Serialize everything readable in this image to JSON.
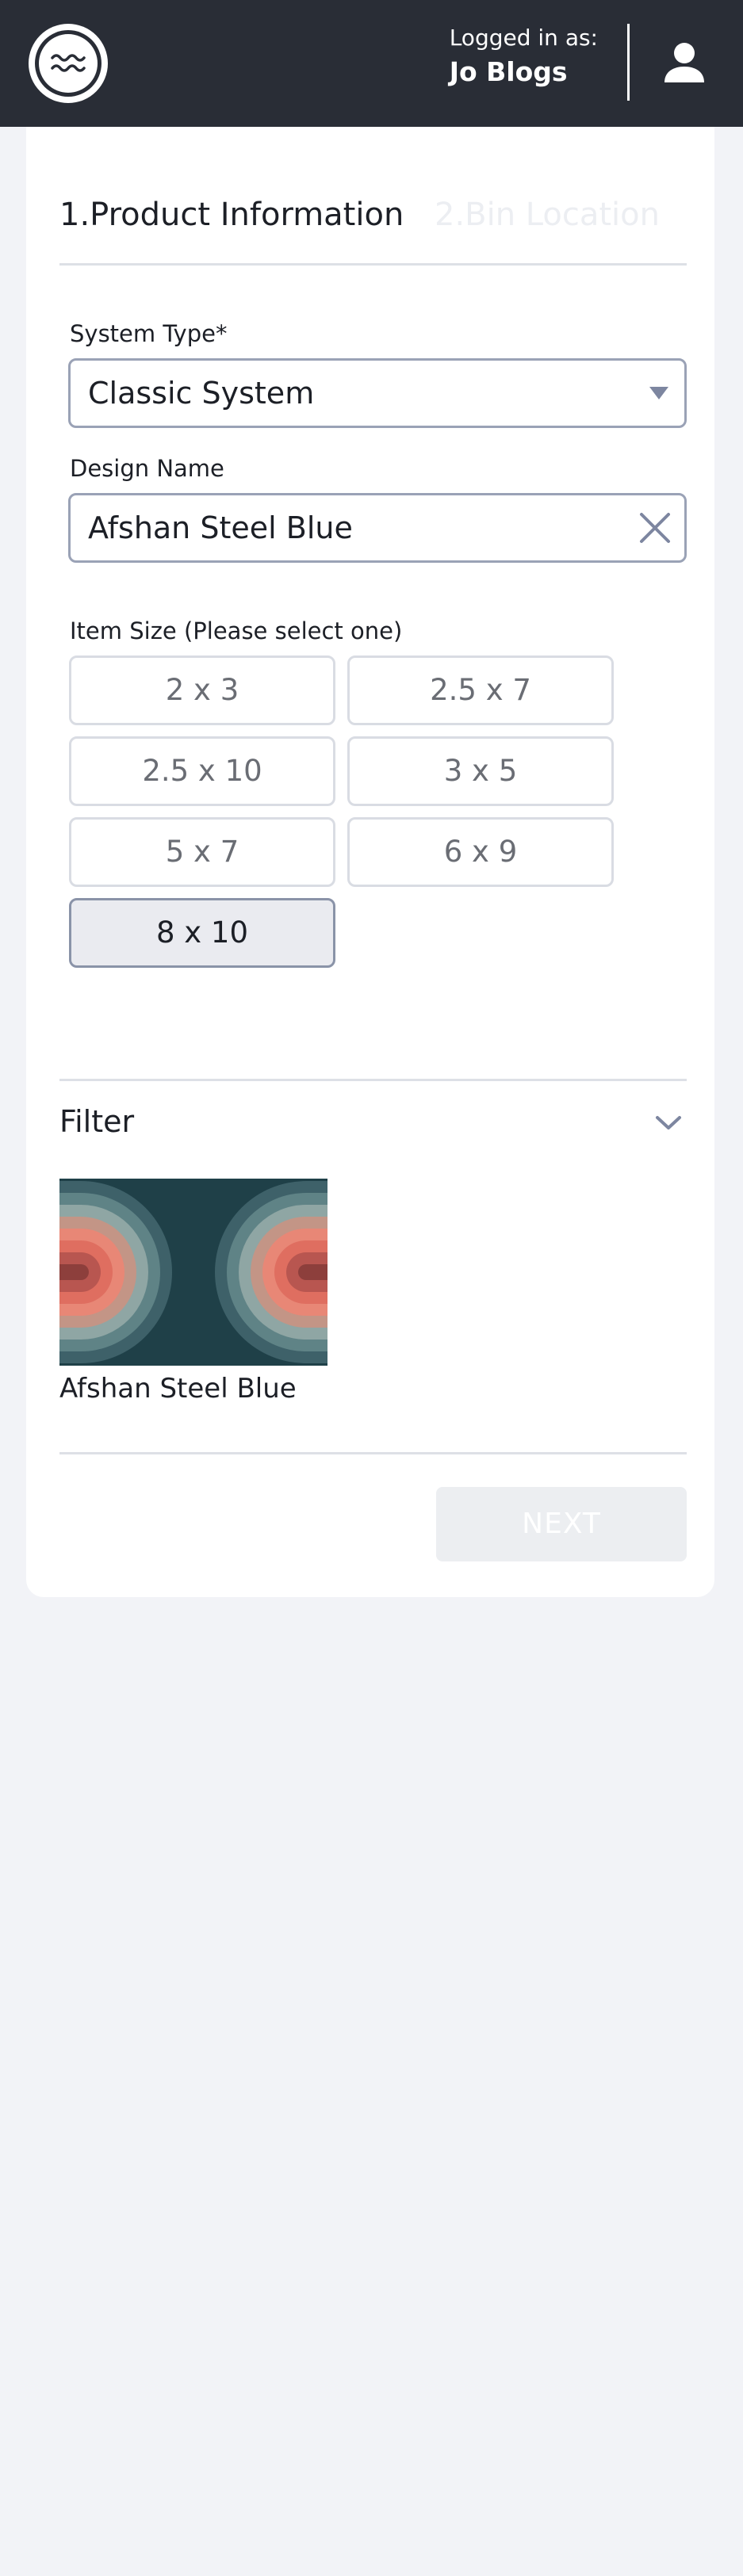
{
  "header": {
    "logged_in_label": "Logged in as:",
    "user_name": "Jo Blogs",
    "logo_icon": "waves-logo-icon",
    "avatar_icon": "user-icon"
  },
  "steps": {
    "step1": "1.Product Information",
    "step2": "2.Bin Location"
  },
  "form": {
    "system_type": {
      "label": "System Type*",
      "value": "Classic System",
      "icon": "caret-down-icon"
    },
    "design_name": {
      "label": "Design Name",
      "value": "Afshan Steel Blue",
      "icon": "close-icon"
    },
    "item_size": {
      "label": "Item Size (Please select one)",
      "options": [
        "2 x 3",
        "2.5 x 7",
        "2.5 x 10",
        "3 x 5",
        "5 x 7",
        "6 x 9",
        "8 x 10"
      ],
      "selected": "8 x 10"
    }
  },
  "filter": {
    "title": "Filter",
    "icon": "chevron-down-icon",
    "results": [
      {
        "name": "Afshan Steel Blue"
      }
    ]
  },
  "actions": {
    "next_label": "NEXT"
  },
  "colors": {
    "topbar": "#292d36",
    "page_bg": "#f2f3f7",
    "accent_border": "#9aa2b6",
    "thumb_dark": "#1f4048",
    "thumb_salmon": "#e88776"
  }
}
